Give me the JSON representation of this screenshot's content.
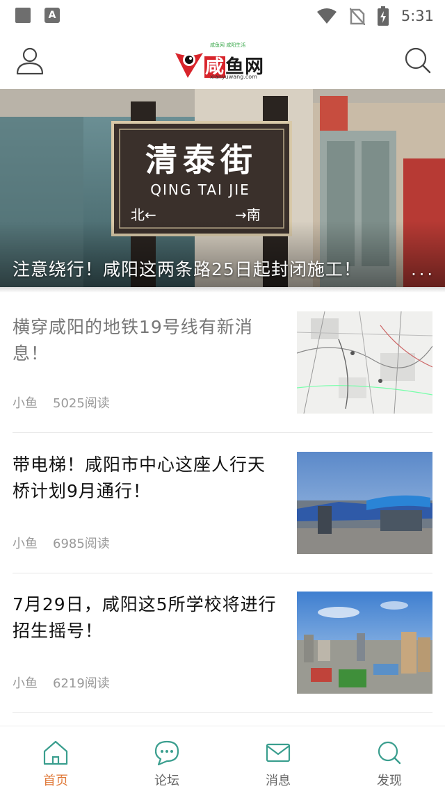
{
  "status_bar": {
    "time": "5:31",
    "badge_letter": "A"
  },
  "header": {
    "logo_tagline": "咸鱼网 咸阳生活",
    "logo_main_red": "咸",
    "logo_main_rest": "鱼网",
    "logo_url": "xianyuwang.com"
  },
  "banner": {
    "caption": "注意绕行！咸阳这两条路25日起封闭施工！",
    "more": "...",
    "sign_chinese": "清泰街",
    "sign_pinyin": "QING TAI JIE",
    "sign_left": "北←",
    "sign_right": "→南"
  },
  "feed": [
    {
      "title": "横穿咸阳的地铁19号线有新消息！",
      "author": "小鱼",
      "reads": "5025阅读",
      "read_state": "read",
      "thumb": "map"
    },
    {
      "title": "带电梯！咸阳市中心这座人行天桥计划9月通行！",
      "author": "小鱼",
      "reads": "6985阅读",
      "read_state": "unread",
      "thumb": "bridge"
    },
    {
      "title": "7月29日，咸阳这5所学校将进行招生摇号！",
      "author": "小鱼",
      "reads": "6219阅读",
      "read_state": "unread",
      "thumb": "city"
    }
  ],
  "bottom_nav": [
    {
      "label": "首页",
      "icon": "home-icon",
      "active": true
    },
    {
      "label": "论坛",
      "icon": "forum-icon",
      "active": false
    },
    {
      "label": "消息",
      "icon": "mail-icon",
      "active": false
    },
    {
      "label": "发现",
      "icon": "discover-icon",
      "active": false
    }
  ],
  "colors": {
    "accent_active": "#e07a3a",
    "nav_icon_teal": "#3a9e8e",
    "logo_red": "#d8242b"
  }
}
